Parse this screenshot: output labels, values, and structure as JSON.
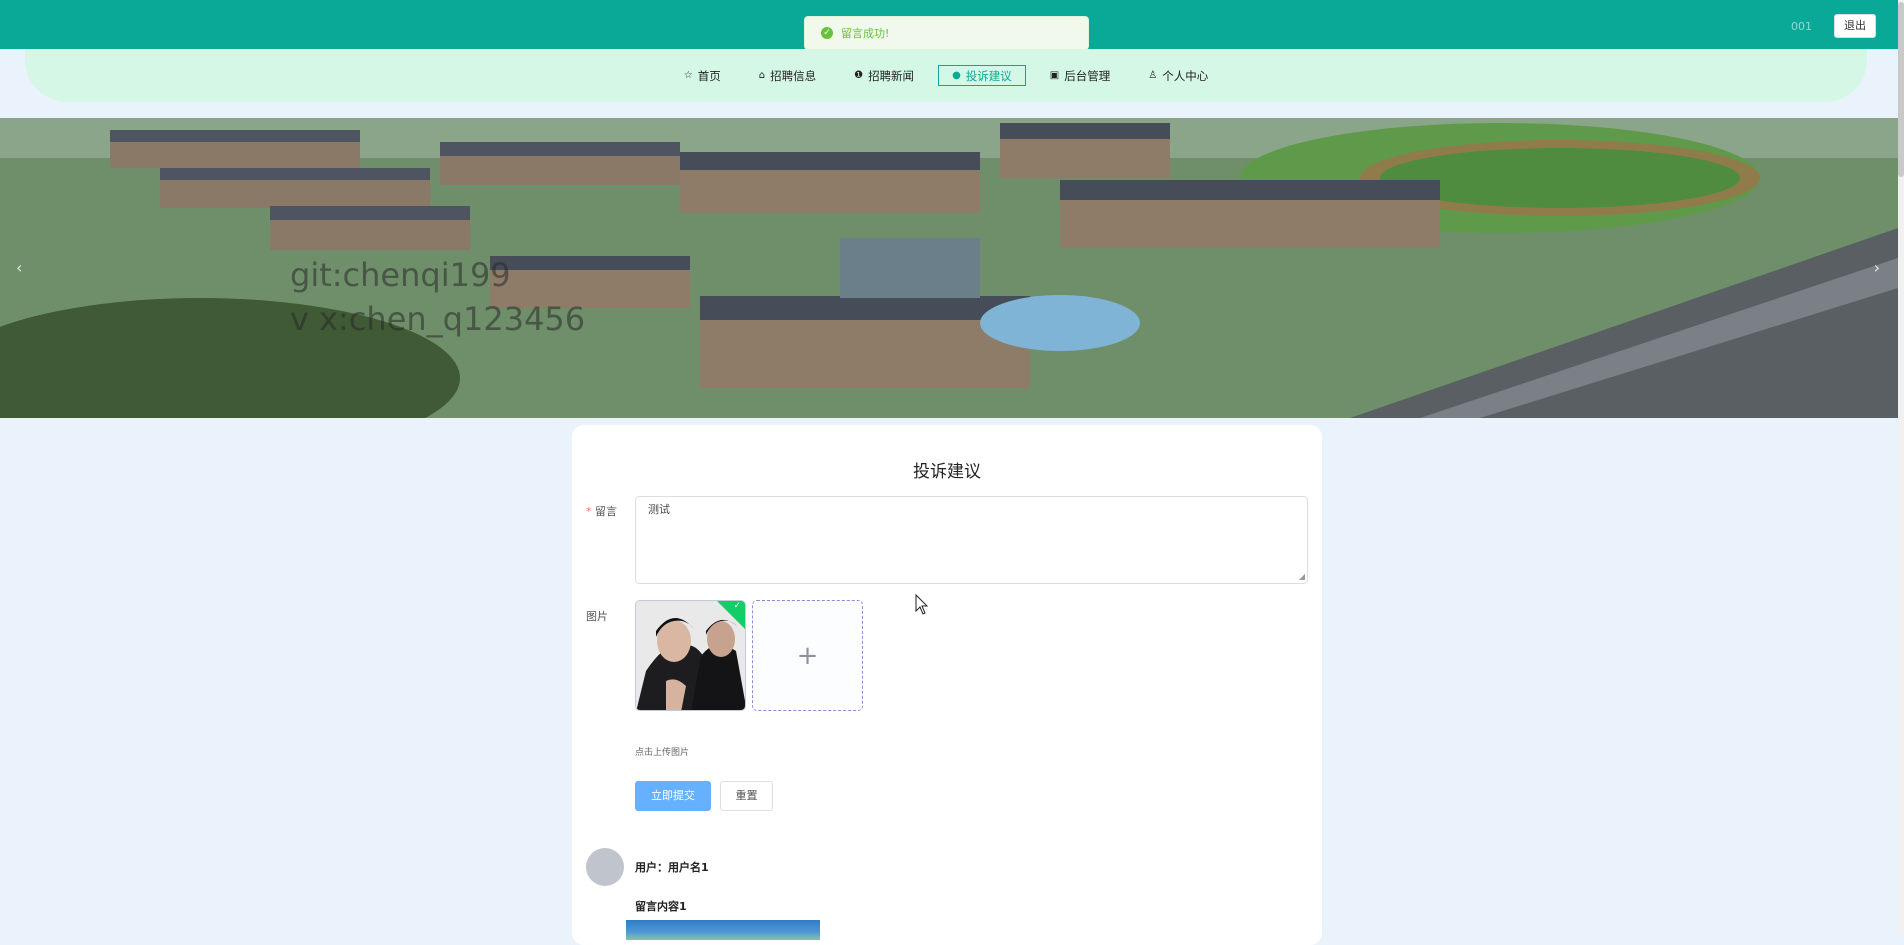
{
  "header": {
    "username": "001",
    "logout_label": "退出"
  },
  "toast": {
    "message": "留言成功!",
    "icon": "check-circle-icon"
  },
  "nav": {
    "items": [
      {
        "label": "首页",
        "icon": "star-icon"
      },
      {
        "label": "招聘信息",
        "icon": "bag-icon"
      },
      {
        "label": "招聘新闻",
        "icon": "info-circle-icon"
      },
      {
        "label": "投诉建议",
        "icon": "warning-circle-icon"
      },
      {
        "label": "后台管理",
        "icon": "building-icon"
      },
      {
        "label": "个人中心",
        "icon": "user-icon"
      }
    ],
    "active_label": "投诉建议"
  },
  "banner": {
    "watermark_line1": "git:chenqi199",
    "watermark_line2": "v x:chen_q123456",
    "prev_icon": "chevron-left-icon",
    "next_icon": "chevron-right-icon"
  },
  "form": {
    "title": "投诉建议",
    "message_label": "留言",
    "message_value": "测试",
    "image_label": "图片",
    "upload_icon": "plus-icon",
    "upload_hint": "点击上传图片",
    "submit_label": "立即提交",
    "reset_label": "重置"
  },
  "comments": [
    {
      "user": "用户：用户名1",
      "content": "留言内容1"
    }
  ],
  "colors": {
    "topbar": "#0aa896",
    "navbar": "#d4f8e5",
    "page_bg": "#eaf3fb",
    "success": "#67c23a",
    "primary_btn": "#66b1ff"
  }
}
